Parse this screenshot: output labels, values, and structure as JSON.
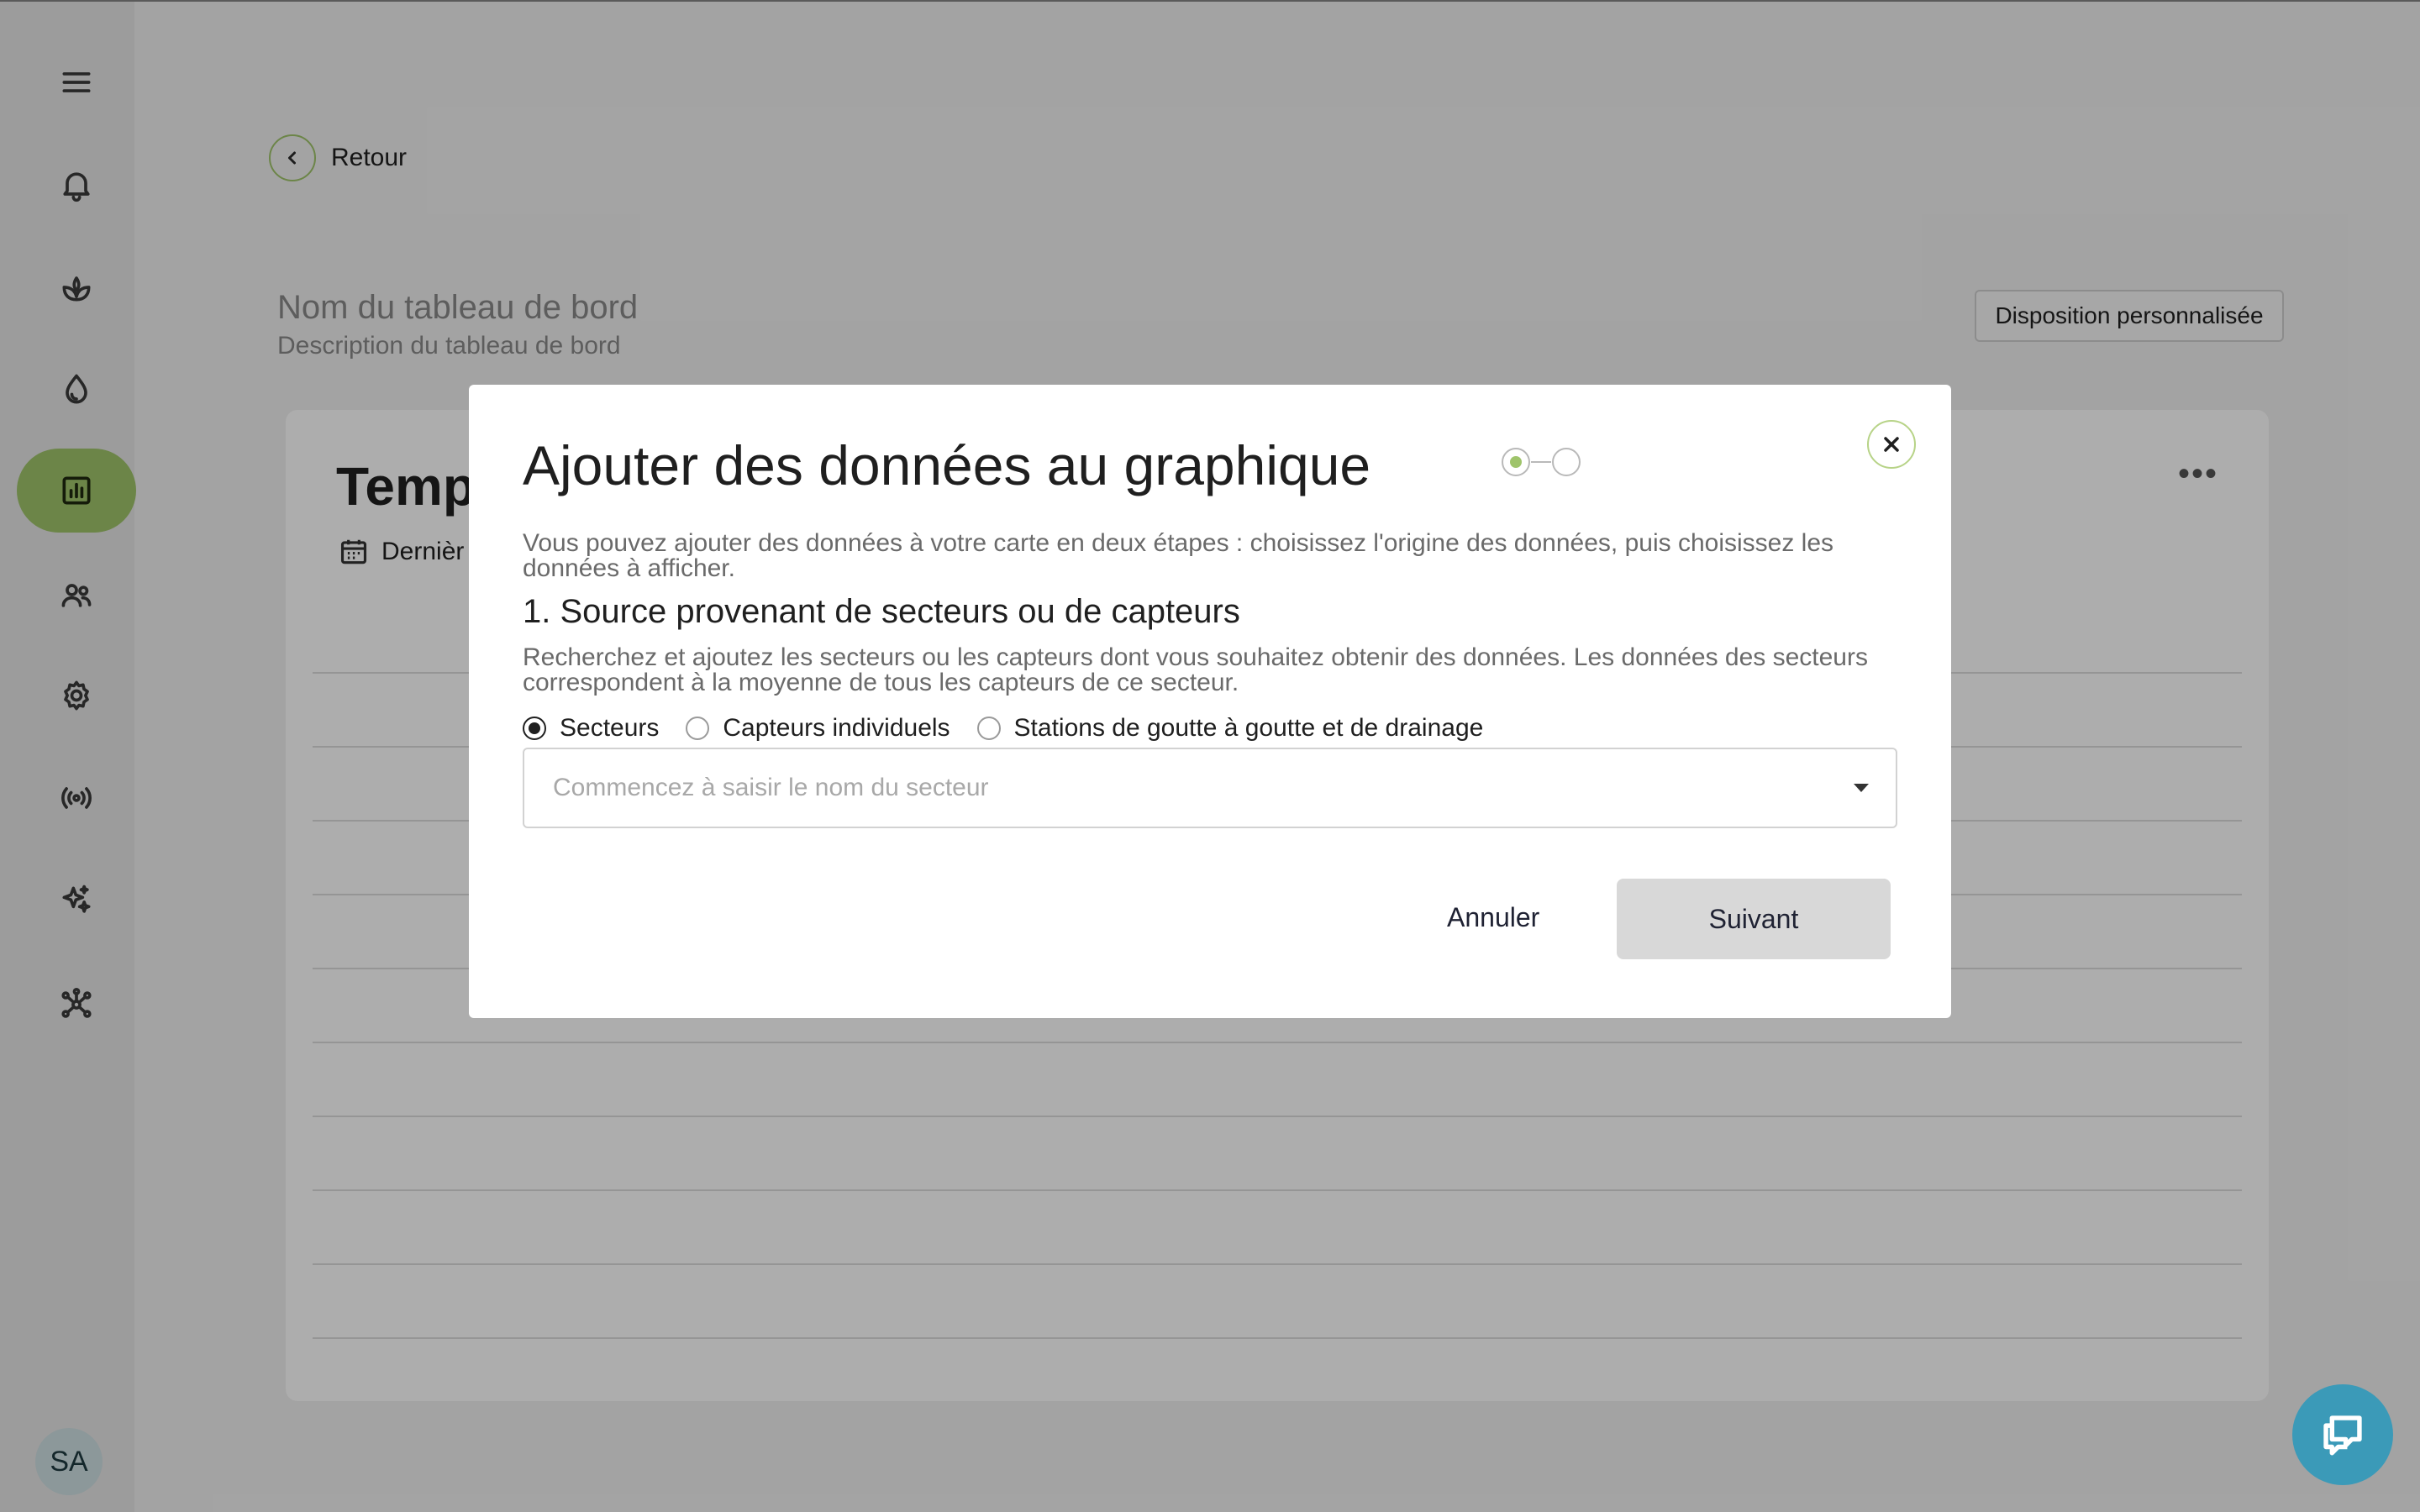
{
  "sidebar": {
    "items": [
      {
        "name": "menu-icon"
      },
      {
        "name": "bell-icon"
      },
      {
        "name": "plant-icon"
      },
      {
        "name": "water-drop-icon"
      },
      {
        "name": "chart-icon",
        "active": true
      },
      {
        "name": "users-icon"
      },
      {
        "name": "gear-icon"
      },
      {
        "name": "broadcast-icon"
      },
      {
        "name": "sparkles-icon"
      },
      {
        "name": "network-icon"
      }
    ],
    "avatar_initials": "SA"
  },
  "header": {
    "back_label": "Retour",
    "dashboard_name_placeholder": "Nom du tableau de bord",
    "dashboard_description_placeholder": "Description du tableau de bord",
    "custom_layout_button": "Disposition personnalisée"
  },
  "card": {
    "title_partial": "Temp",
    "date_range_partial": "Dernièr"
  },
  "modal": {
    "title": "Ajouter des données au graphique",
    "intro": "Vous pouvez ajouter des données à votre carte en deux étapes : choisissez l'origine des données, puis choisissez les données à afficher.",
    "step_heading": "1. Source provenant de secteurs ou de capteurs",
    "step_description": "Recherchez et ajoutez les secteurs ou les capteurs dont vous souhaitez obtenir des données. Les données des secteurs correspondent à la moyenne de tous les capteurs de ce secteur.",
    "radio_options": [
      {
        "label": "Secteurs",
        "checked": true
      },
      {
        "label": "Capteurs individuels",
        "checked": false
      },
      {
        "label": "Stations de goutte à goutte et de drainage",
        "checked": false
      }
    ],
    "search": {
      "value": "",
      "placeholder": "Commencez à saisir le nom du secteur"
    },
    "cancel_label": "Annuler",
    "next_label": "Suivant",
    "stepper": {
      "current_step": 1,
      "total_steps": 2
    }
  },
  "colors": {
    "accent_green": "#9fc46b",
    "chat_blue": "#3b9ab8"
  }
}
